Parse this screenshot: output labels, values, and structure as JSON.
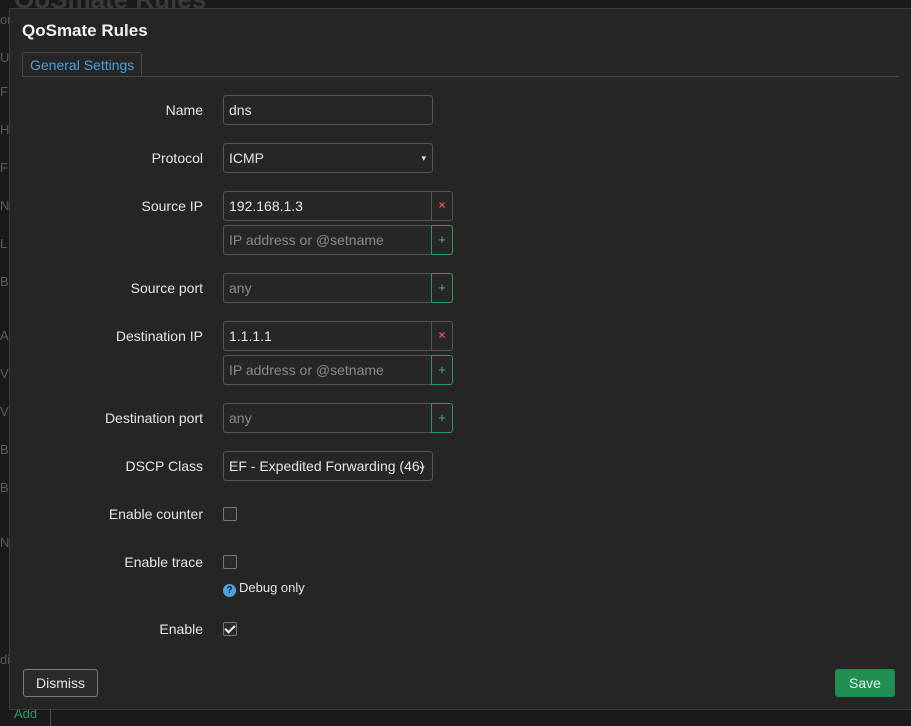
{
  "background": {
    "title": "QoSmate Rules",
    "letters": [
      "or",
      "U",
      "F",
      "H",
      "F",
      "N",
      "L",
      "B",
      "A",
      "V",
      "V",
      "B",
      "B",
      "N",
      "di"
    ],
    "add_label": "Add"
  },
  "modal": {
    "title": "QoSmate Rules",
    "tab_label": "General Settings",
    "fields": {
      "name": {
        "label": "Name",
        "value": "dns"
      },
      "protocol": {
        "label": "Protocol",
        "value": "ICMP"
      },
      "source_ip": {
        "label": "Source IP",
        "value": "192.168.1.3",
        "placeholder": "IP address or @setname"
      },
      "source_port": {
        "label": "Source port",
        "placeholder": "any"
      },
      "dest_ip": {
        "label": "Destination IP",
        "value": "1.1.1.1",
        "placeholder": "IP address or @setname"
      },
      "dest_port": {
        "label": "Destination port",
        "placeholder": "any"
      },
      "dscp": {
        "label": "DSCP Class",
        "value": "EF - Expedited Forwarding (46)"
      },
      "counter": {
        "label": "Enable counter",
        "checked": false
      },
      "trace": {
        "label": "Enable trace",
        "checked": false,
        "help": "Debug only"
      },
      "enable": {
        "label": "Enable",
        "checked": true
      }
    },
    "dismiss_label": "Dismiss",
    "save_label": "Save"
  },
  "icons": {
    "remove": "×",
    "add": "+",
    "help": "?",
    "select_arrow": "▾",
    "select_chevron": "⌄"
  },
  "colors": {
    "accent": "#4aa3df",
    "save": "#1f8f52",
    "add": "#2a9a5e",
    "remove": "#d9534f"
  }
}
